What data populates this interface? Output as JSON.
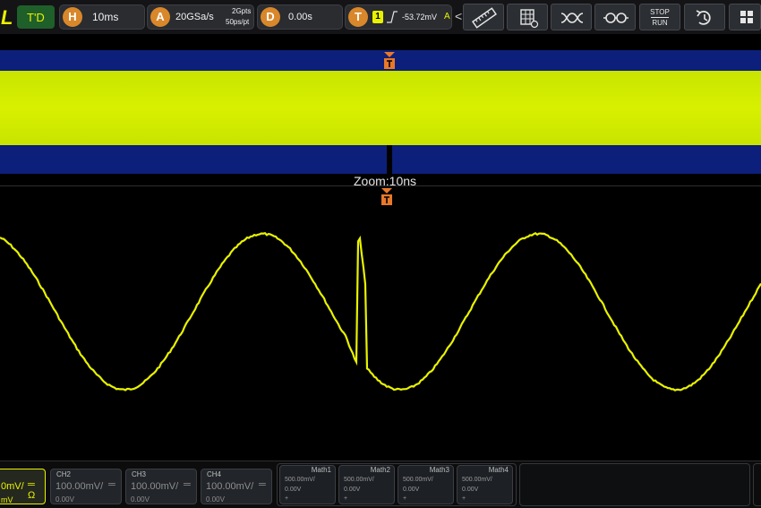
{
  "topbar": {
    "logo": "L",
    "trigger_mode": "T'D",
    "horizontal": {
      "badge": "H",
      "value": "10ms"
    },
    "acquisition": {
      "badge": "A",
      "rate": "20GSa/s",
      "points": "2Gpts",
      "per_point": "50ps/pt"
    },
    "delay": {
      "badge": "D",
      "value": "0.00s"
    },
    "trigger": {
      "badge": "T",
      "source": "1",
      "level": "-53.72mV",
      "coupling": "A"
    },
    "collapse_arrow": "<",
    "tools": [
      {
        "name": "ruler-icon"
      },
      {
        "name": "grid-settings-icon"
      },
      {
        "name": "waveform-cross-icon"
      },
      {
        "name": "clear-display-icon"
      },
      {
        "name": "stop-run-button",
        "top": "STOP",
        "bottom": "RUN"
      },
      {
        "name": "history-icon"
      },
      {
        "name": "layout-icon"
      }
    ]
  },
  "zoom": {
    "label": "Zoom:10ns",
    "trigger_marker": "T"
  },
  "channels": [
    {
      "title": "",
      "scale": "0mV/",
      "offset": "mV",
      "extra": "═ Ω",
      "active": true
    },
    {
      "title": "CH2",
      "scale": "100.00mV/",
      "offset": "0.00V",
      "extra": "═"
    },
    {
      "title": "CH3",
      "scale": "100.00mV/",
      "offset": "0.00V",
      "extra": "═"
    },
    {
      "title": "CH4",
      "scale": "100.00mV/",
      "offset": "0.00V",
      "extra": "═"
    }
  ],
  "maths": [
    {
      "title": "Math1",
      "scale": "500.00mV/",
      "offset": "0.00V",
      "plus": "+"
    },
    {
      "title": "Math2",
      "scale": "500.00mV/",
      "offset": "0.00V",
      "plus": "+"
    },
    {
      "title": "Math3",
      "scale": "500.00mV/",
      "offset": "0.00V",
      "plus": "+"
    },
    {
      "title": "Math4",
      "scale": "500.00mV/",
      "offset": "0.00V",
      "plus": "+"
    }
  ],
  "colors": {
    "ch1": "#e8f200",
    "trigger": "#e8782a",
    "overview_bg": "#0c1f7a",
    "accent_badge": "#d9872b"
  }
}
